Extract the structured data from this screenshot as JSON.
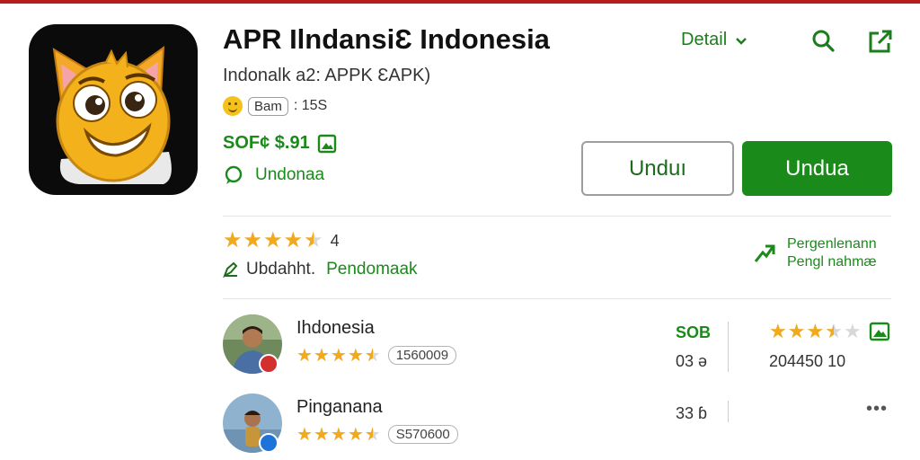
{
  "colors": {
    "accent": "#1a8a1a",
    "star": "#f2a91b",
    "top_bar": "#b71c1c"
  },
  "app": {
    "title": "APR IlndansiƐ Indonesia",
    "subtitle": "Indonalk a2: APPK ƐAPK)",
    "age_badge": "Bam",
    "age_count": ": 15S",
    "price": "SOF¢ $.91",
    "developer": "Undonaa"
  },
  "header": {
    "detail_label": "Detail",
    "icons": [
      "search-icon",
      "share-icon"
    ]
  },
  "buttons": {
    "secondary": "Unduı",
    "primary": "Undua"
  },
  "rating": {
    "stars": 4.5,
    "value": "4",
    "update_label": "Ubdahht.",
    "pending_label": "Pendomaak"
  },
  "performance": {
    "line1": "Pergenlenann",
    "line2": "Pengl nahmæ"
  },
  "reviews": [
    {
      "name": "Ihdonesia",
      "stars": 4.5,
      "count": "1560009",
      "col_top": "SOB",
      "col_bottom": "03 ə",
      "right_stars": 3.5,
      "right_number": "204450 10"
    },
    {
      "name": "Pinganana",
      "stars": 4.5,
      "count": "S570600",
      "col_top": "33 ɓ",
      "more": "•••"
    }
  ]
}
